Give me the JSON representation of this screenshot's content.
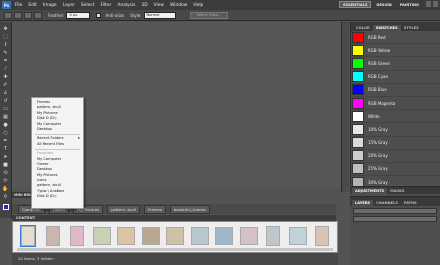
{
  "app": {
    "logo_text": "Ps"
  },
  "menubar": {
    "items": [
      "File",
      "Edit",
      "Image",
      "Layer",
      "Select",
      "Filter",
      "Analysis",
      "3D",
      "View",
      "Window",
      "Help"
    ],
    "workspaces": [
      "ESSENTIALS",
      "DESIGN",
      "PAINTING"
    ]
  },
  "options": {
    "feather_label": "Feather:",
    "feather_value": "0 px",
    "antialias_label": "Anti-alias",
    "style_label": "Style:",
    "style_value": "Normal",
    "refine_edge_label": "Refine Edge..."
  },
  "swatches_panel": {
    "tabs": [
      "COLOR",
      "SWATCHES",
      "STYLES"
    ],
    "items": [
      {
        "name": "RGB Red",
        "color": "#ff0000"
      },
      {
        "name": "RGB Yellow",
        "color": "#ffff00"
      },
      {
        "name": "RGB Green",
        "color": "#00ff00"
      },
      {
        "name": "RGB Cyan",
        "color": "#00ffff"
      },
      {
        "name": "RGB Blue",
        "color": "#0000ff"
      },
      {
        "name": "RGB Magenta",
        "color": "#ff00ff"
      },
      {
        "name": "White",
        "color": "#ffffff"
      },
      {
        "name": "10% Gray",
        "color": "#e6e6e6"
      },
      {
        "name": "15% Gray",
        "color": "#d9d9d9"
      },
      {
        "name": "20% Gray",
        "color": "#cccccc"
      },
      {
        "name": "25% Gray",
        "color": "#bfbfbf"
      },
      {
        "name": "30% Gray",
        "color": "#b3b3b3"
      }
    ]
  },
  "adjustments_panel": {
    "tabs": [
      "ADJUSTMENTS",
      "MASKS"
    ]
  },
  "layers_panel": {
    "tabs": [
      "LAYERS",
      "CHANNELS",
      "PATHS"
    ]
  },
  "context_menu": {
    "items": [
      {
        "label": "Frames"
      },
      {
        "label": "pattern, skull"
      },
      {
        "label": "My Pictures"
      },
      {
        "label": "Disk D (D:)"
      },
      {
        "label": "My Computer"
      },
      {
        "label": "Desktop"
      },
      {
        "sep": true
      },
      {
        "label": "Recent Folders",
        "submenu": true
      },
      {
        "label": "All Recent Files"
      },
      {
        "sep": true
      },
      {
        "label": "Favorites",
        "disabled": true
      },
      {
        "label": "My Computer"
      },
      {
        "label": "Owner"
      },
      {
        "label": "Desktop"
      },
      {
        "label": "My Pictures"
      },
      {
        "label": "icons"
      },
      {
        "label": "pattern, skull"
      },
      {
        "label": "Туры \\ Альбом"
      },
      {
        "label": "Disk D (D:)"
      }
    ]
  },
  "mini_bridge": {
    "tab_label": "MINI BRIDGE",
    "breadcrumbs": [
      "Computer",
      "Owner",
      "My Pictures",
      "pattern, skull",
      "Frames",
      "beautiful_frames"
    ],
    "content_label": "CONTENT",
    "status": "22 items, 3 hidden",
    "thumbnails": [
      "#e6dccd",
      "#c9b6b0",
      "#e0b8c8",
      "#c9d1b5",
      "#d8c4a6",
      "#b8a892",
      "#cfc1a6",
      "#b6c8cc",
      "#9fb6c8",
      "#d4c0c8",
      "#c0c6ce",
      "#bfd3d6",
      "#d8c2b4"
    ]
  }
}
